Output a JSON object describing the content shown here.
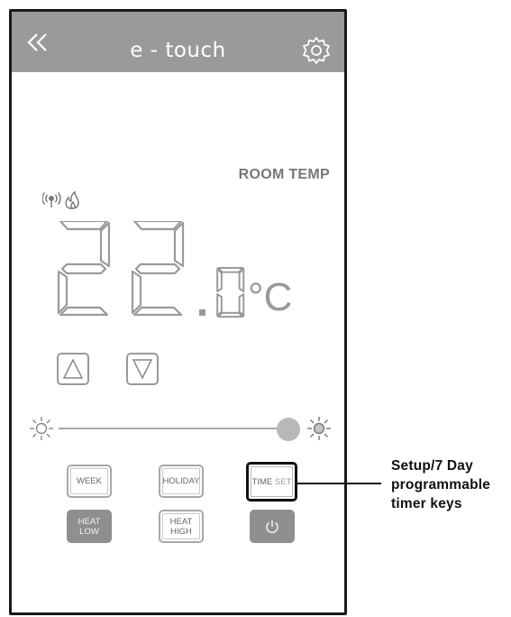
{
  "header": {
    "title": "e - touch",
    "back_icon": "double-chevron-left-icon",
    "settings_icon": "gear-icon"
  },
  "display": {
    "room_label": "ROOM TEMP",
    "temperature_integer": "22",
    "temperature_decimal": "0",
    "temperature_text": "22.0",
    "unit": "°C",
    "status_icons": [
      "wireless-signal-icon",
      "flame-icon"
    ]
  },
  "controls": {
    "up_icon": "triangle-up-icon",
    "down_icon": "triangle-down-icon",
    "brightness": {
      "min_icon": "sun-outline-icon",
      "max_icon": "sun-filled-icon",
      "level": 1.0
    }
  },
  "keys": {
    "week": "WEEK",
    "holiday": "HOLIDAY",
    "time_set_a": "TIME",
    "time_set_b": "SET",
    "heat_low_a": "HEAT",
    "heat_low_b": "LOW",
    "heat_high_a": "HEAT",
    "heat_high_b": "HIGH",
    "power_icon": "power-icon"
  },
  "annotation": {
    "line1": "Setup/7 Day",
    "line2": "programmable",
    "line3": "timer keys"
  },
  "colors": {
    "header_bg": "#9a9a9a",
    "segment": "#9a9a9a",
    "dark_key": "#8f8f8f"
  }
}
